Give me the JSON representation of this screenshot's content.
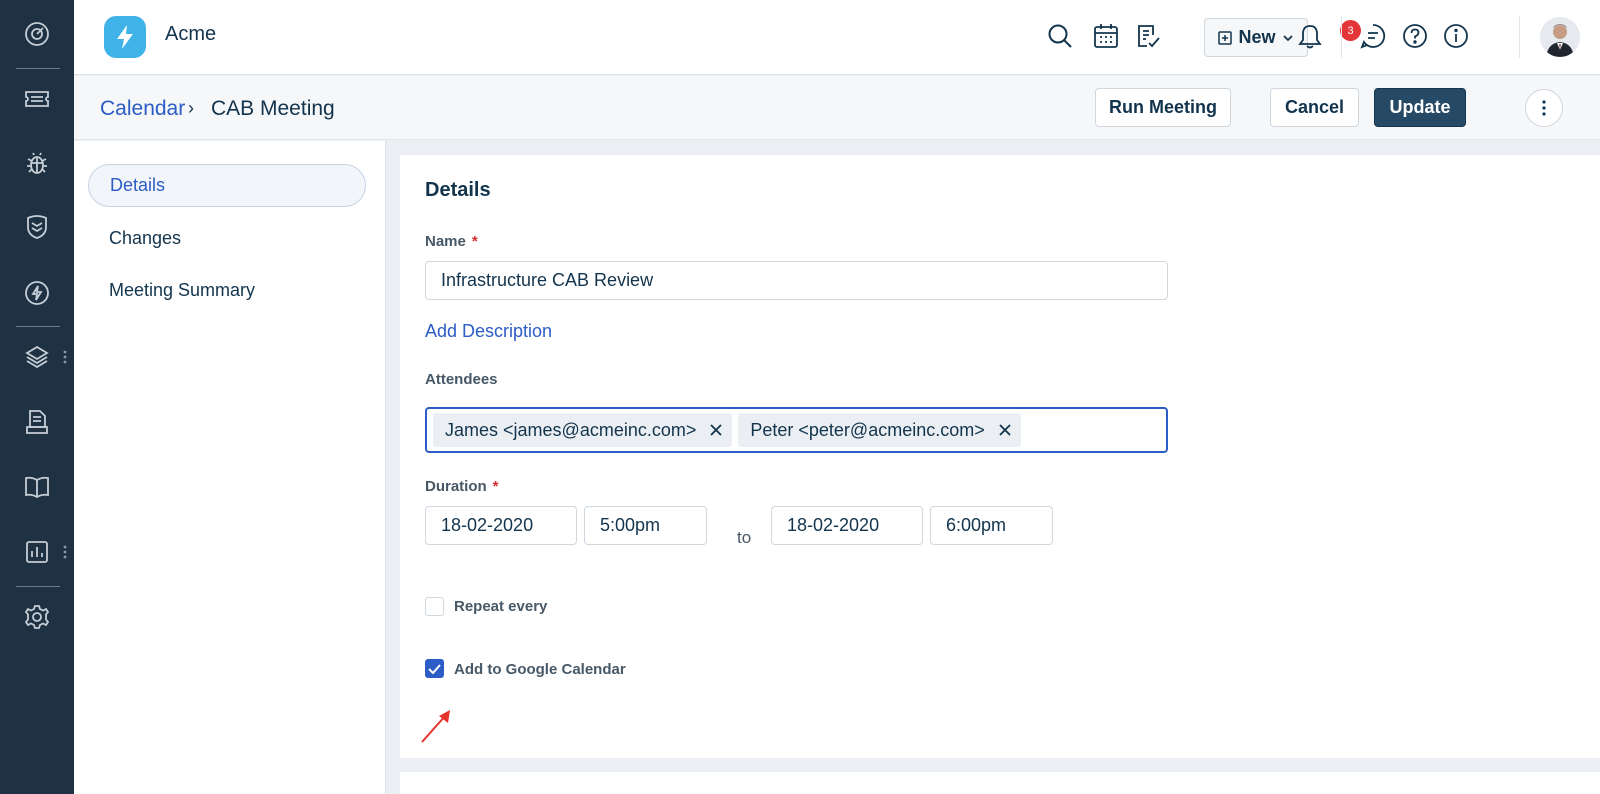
{
  "app": {
    "brand": "Acme"
  },
  "rail": {
    "icons": [
      "dashboard-icon",
      "ticket-icon",
      "bug-icon",
      "shield-icon",
      "lightning-icon",
      "layers-icon",
      "document-icon",
      "book-icon",
      "analytics-icon",
      "settings-icon"
    ]
  },
  "topbar": {
    "new_label": "New",
    "notification_count": "3",
    "icons": [
      "search-icon",
      "calendar-icon",
      "checklist-icon",
      "bell-icon",
      "chat-icon",
      "help-icon",
      "info-icon"
    ]
  },
  "breadcrumb": {
    "parent": "Calendar",
    "separator": "›",
    "current": "CAB Meeting"
  },
  "actions": {
    "run": "Run Meeting",
    "cancel": "Cancel",
    "update": "Update"
  },
  "leftnav": {
    "items": [
      {
        "label": "Details"
      },
      {
        "label": "Changes"
      },
      {
        "label": "Meeting Summary"
      }
    ]
  },
  "form": {
    "heading": "Details",
    "name_label": "Name",
    "required_mark": "*",
    "name_value": "Infrastructure CAB Review",
    "add_description": "Add Description",
    "attendees_label": "Attendees",
    "attendees": [
      {
        "label": "James <james@acmeinc.com>"
      },
      {
        "label": "Peter <peter@acmeinc.com>"
      }
    ],
    "duration_label": "Duration",
    "start_date": "18-02-2020",
    "start_time": "5:00pm",
    "to_label": "to",
    "end_date": "18-02-2020",
    "end_time": "6:00pm",
    "repeat_label": "Repeat every",
    "repeat_checked": false,
    "google_label": "Add to Google Calendar",
    "google_checked": true
  },
  "colors": {
    "rail": "#1f3244",
    "accent": "#2c5cc5",
    "primary_button": "#264966",
    "badge": "#e43538",
    "annotation_arrow": "#e5322d"
  }
}
